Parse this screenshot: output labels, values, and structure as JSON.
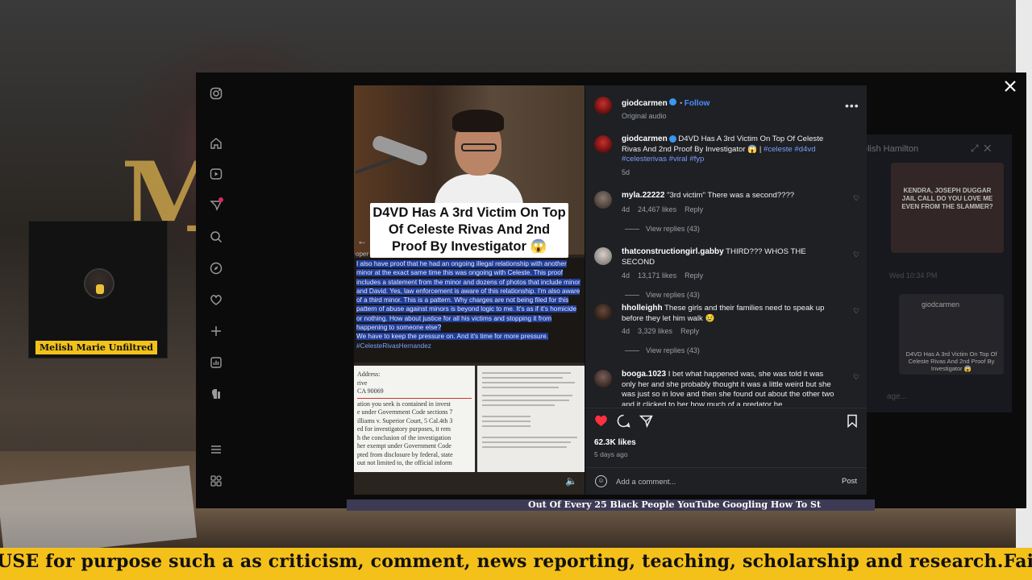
{
  "background": {
    "logo_letter": "M"
  },
  "webcam": {
    "name": "Melish Marie Unfiltred"
  },
  "instagram": {
    "close_icon": "×",
    "sidebar_icons": [
      "instagram-icon",
      "home-icon",
      "reels-icon",
      "messages-icon",
      "search-icon",
      "explore-icon",
      "notifications-icon",
      "create-icon",
      "dashboard-icon",
      "threads-icon",
      "menu-icon",
      "meta-icon"
    ],
    "video": {
      "headline": "D4VD Has A 3rd Victim On Top Of Celeste Rivas And 2nd Proof By Investigator 😱",
      "oper": "oper",
      "statement_main": "I also have proof that he had an ongoing illegal relationship with another minor at the exact same time this was ongoing with Celeste. This proof includes a statement from the minor and dozens of photos that include minor and David. Yes, law enforcement is aware of this relationship. I'm also aware of a third minor. This is a pattern. Why charges are not being filed for this pattern of abuse against minors is beyond logic to me. It's as if it's homicide or nothing. How about justice for all his victims and stopping it from happening to someone else?",
      "statement_line2": "We have to keep the pressure on. And it's time for more pressure.",
      "statement_tag": "#CelesteRivasHernandez",
      "doc_lines": [
        "Address:",
        "rive",
        "CA 90069",
        "ation you seek is contained in invest",
        "e under Government Code sections 7",
        "illiams v. Superior Court, 5 Cal.4th 3",
        "ed for investigatory purposes, it rem",
        "h the conclusion of the investigation",
        "her exempt under Government Code",
        "pted from disclosure by federal, state",
        "out not limited to, the official inform"
      ]
    },
    "post": {
      "username": "giodcarmen",
      "follow_label": "Follow",
      "audio": "Original audio",
      "caption": "D4VD Has A 3rd Victim On Top Of Celeste Rivas And 2nd Proof By Investigator 😱 |",
      "caption_tags_1": "#celeste #d4vd",
      "caption_tags_2": "#celesterivas #viral #fyp",
      "caption_age": "5d",
      "likes": "62.3K likes",
      "posted": "5 days ago",
      "comment_placeholder": "Add a comment...",
      "post_label": "Post"
    },
    "comments": [
      {
        "user": "myla.22222",
        "text": "\"3rd victim\" There was a second????",
        "age": "4d",
        "likes": "24,467 likes",
        "reply": "Reply",
        "view_replies": "View replies (43)"
      },
      {
        "user": "thatconstructiongirl.gabby",
        "text": "THIRD??? WHOS THE SECOND",
        "age": "4d",
        "likes": "13,171 likes",
        "reply": "Reply",
        "view_replies": "View replies (43)"
      },
      {
        "user": "hholleighh",
        "text": "These girls and their families need to speak up before they let him walk 😢",
        "age": "4d",
        "likes": "3,329 likes",
        "reply": "Reply",
        "view_replies": "View replies (43)"
      },
      {
        "user": "booga.1023",
        "text": "I bet what happened was, she was told it was only her and she probably thought it was a little weird but she was just so in love and then she found out about the other two and it clicked to her how much of a predator he"
      }
    ],
    "dm_panel": {
      "name": "elish Hamilton",
      "thumb1_text": "KENDRA, JOSEPH DUGGAR JAIL CALL DO YOU LOVE ME EVEN FROM THE SLAMMER?",
      "time": "Wed 10:34 PM",
      "thumb2_user": "giodcarmen",
      "thumb2_text": "D4VD Has A 3rd Victim On Top Of Celeste Rivas And 2nd Proof By Investigator 😱",
      "input_hint": "age..."
    }
  },
  "below_strip": "Out Of Every 25 Black People YouTube Googling How To St",
  "ticker": "USE for purpose such a as criticism, comment, news reporting, teaching, scholarship and research.Fair u"
}
